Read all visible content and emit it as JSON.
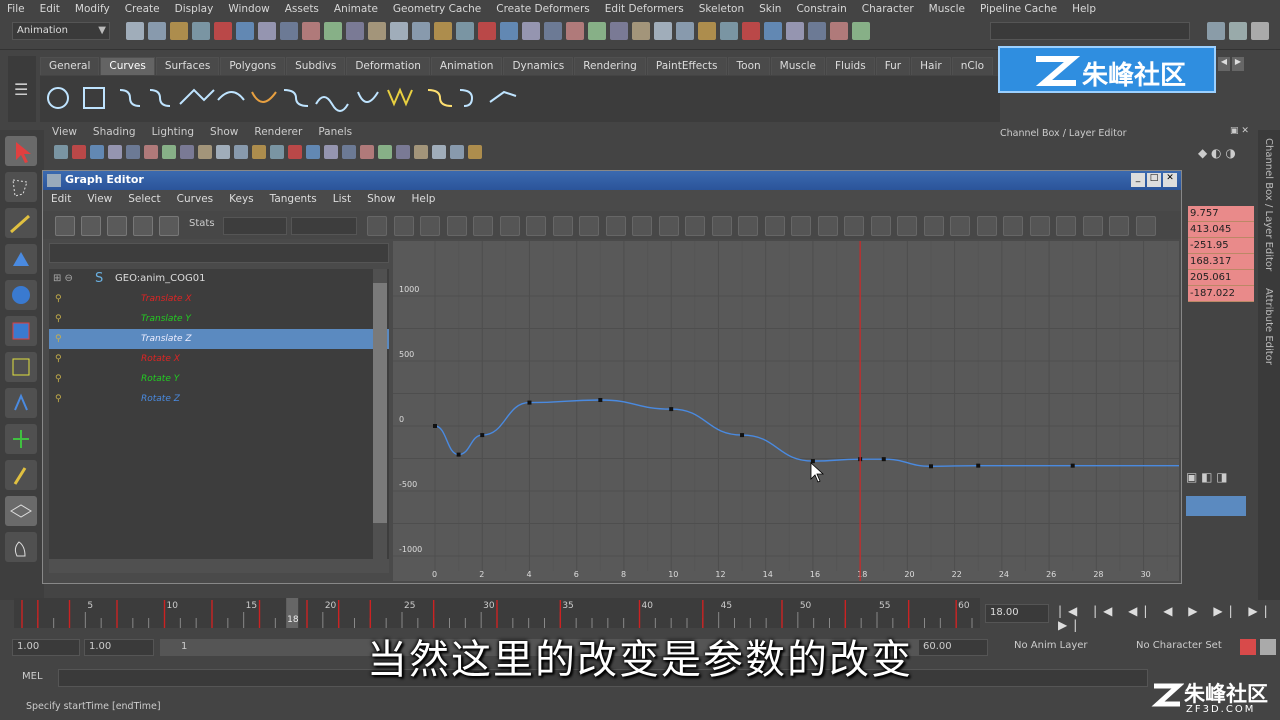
{
  "menubar": [
    "File",
    "Edit",
    "Modify",
    "Create",
    "Display",
    "Window",
    "Assets",
    "Animate",
    "Geometry Cache",
    "Create Deformers",
    "Edit Deformers",
    "Skeleton",
    "Skin",
    "Constrain",
    "Character",
    "Muscle",
    "Pipeline Cache",
    "Help"
  ],
  "mode_selector": "Animation",
  "shelf_tabs": [
    "General",
    "Curves",
    "Surfaces",
    "Polygons",
    "Subdivs",
    "Deformation",
    "Animation",
    "Dynamics",
    "Rendering",
    "PaintEffects",
    "Toon",
    "Muscle",
    "Fluids",
    "Fur",
    "Hair",
    "nClo"
  ],
  "active_shelf_tab": "Curves",
  "panel_menu": [
    "View",
    "Shading",
    "Lighting",
    "Show",
    "Renderer",
    "Panels"
  ],
  "channel_box_title": "Channel Box / Layer Editor",
  "channel_values": [
    "9.757",
    "413.045",
    "-251.95",
    "168.317",
    "205.061",
    "-187.022"
  ],
  "side_tabs": [
    "Channel Box / Layer Editor",
    "Attribute Editor"
  ],
  "graph_editor": {
    "title": "Graph Editor",
    "menu": [
      "Edit",
      "View",
      "Select",
      "Curves",
      "Keys",
      "Tangents",
      "List",
      "Show",
      "Help"
    ],
    "stats_label": "Stats",
    "outliner_root": "GEO:anim_COG01",
    "channels": [
      {
        "label": "Translate X",
        "color": "#e02424"
      },
      {
        "label": "Translate Y",
        "color": "#22cc22"
      },
      {
        "label": "Translate Z",
        "color": "#4a8ae0"
      },
      {
        "label": "Rotate X",
        "color": "#e02424"
      },
      {
        "label": "Rotate Y",
        "color": "#22cc22"
      },
      {
        "label": "Rotate Z",
        "color": "#4a8ae0"
      }
    ],
    "selected_channel": "Translate Z",
    "current_time": 18
  },
  "chart_data": {
    "type": "line",
    "y_ticks": [
      1000,
      500,
      0,
      -500,
      -1000
    ],
    "x_ticks": [
      0,
      2,
      4,
      6,
      8,
      10,
      12,
      14,
      16,
      18,
      20,
      22,
      24,
      26,
      28,
      30
    ],
    "xlim": [
      0,
      31.5
    ],
    "ylim": [
      -1000,
      1000
    ],
    "grid": true,
    "series": [
      {
        "color": "#4a8ae0",
        "keys": [
          [
            0,
            0
          ],
          [
            1,
            -220
          ],
          [
            2,
            -70
          ],
          [
            4,
            180
          ],
          [
            7,
            200
          ],
          [
            10,
            130
          ],
          [
            13,
            -70
          ],
          [
            16,
            -270
          ],
          [
            18,
            -255
          ],
          [
            19,
            -255
          ],
          [
            21,
            -310
          ],
          [
            23,
            -305
          ],
          [
            27,
            -305
          ],
          [
            31.5,
            -305
          ]
        ]
      }
    ],
    "current_time": 18
  },
  "timeline": {
    "ticks": [
      "5",
      "10",
      "15",
      "20",
      "25",
      "30",
      "35",
      "40",
      "45",
      "50",
      "55",
      "60"
    ],
    "current": "18",
    "current_field": "18.00"
  },
  "range": {
    "start": "1.00",
    "playstart": "1.00",
    "marker": "1",
    "end": "60.00",
    "anim_layer": "No Anim Layer",
    "char_set": "No Character Set"
  },
  "mel_label": "MEL",
  "status_text": "Specify startTime [endTime]",
  "subtitle": "当然这里的改变是参数的改变",
  "logo_text": "朱峰社区",
  "logo2_text": "朱峰社区",
  "logo2_url": "ZF3D.COM"
}
